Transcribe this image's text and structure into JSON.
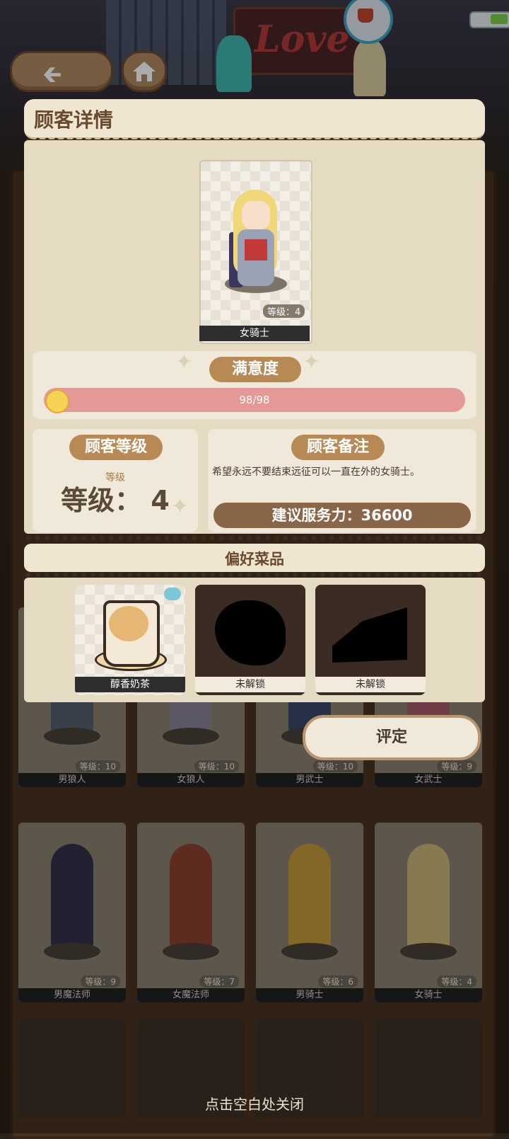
{
  "header": {
    "title": "顾客详情",
    "back_icon": "left-arrow-icon",
    "home_icon": "home-icon"
  },
  "background": {
    "sign_text": "Love"
  },
  "customer": {
    "name": "女骑士",
    "level_badge": "等级：4",
    "satisfaction_label": "满意度",
    "satisfaction_value": "98/98",
    "satisfaction_fraction": 1.0,
    "level_section_label": "顾客等级",
    "level_small": "等级",
    "level_big": "等级： 4",
    "notes_label": "顾客备注",
    "notes_text": "希望永远不要结束远征可以一直在外的女骑士。",
    "suggested_service": "建议服务力：36600"
  },
  "preferences": {
    "title": "偏好菜品",
    "dishes": [
      {
        "name": "醇香奶茶",
        "unlocked": true
      },
      {
        "name": "未解锁",
        "unlocked": false
      },
      {
        "name": "未解锁",
        "unlocked": false
      }
    ]
  },
  "rate_button": "评定",
  "grid": {
    "row1": [
      {
        "name": "男狼人",
        "level": "等级：10"
      },
      {
        "name": "女狼人",
        "level": "等级：10"
      },
      {
        "name": "男武士",
        "level": "等级：10"
      },
      {
        "name": "女武士",
        "level": "等级：9"
      }
    ],
    "row2": [
      {
        "name": "男魔法师",
        "level": "等级：9"
      },
      {
        "name": "女魔法师",
        "level": "等级：7"
      },
      {
        "name": "男骑士",
        "level": "等级：6"
      },
      {
        "name": "女骑士",
        "level": "等级：4"
      }
    ]
  },
  "close_hint": "点击空白处关闭",
  "colors": {
    "accent": "#b78a55",
    "panel": "#e5dbc3",
    "satisfaction_bar": "#e59898",
    "power_bar": "#8a6648"
  }
}
